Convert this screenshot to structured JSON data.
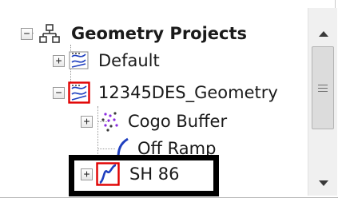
{
  "tree": {
    "root": {
      "label": "Geometry Projects",
      "expander": "−",
      "icon": "network-tree-icon"
    },
    "items": [
      {
        "label": "Default",
        "expander": "+",
        "icon": "alignment-set-icon"
      },
      {
        "label": "12345DES_Geometry",
        "expander": "−",
        "icon": "alignment-set-selected-icon"
      },
      {
        "label": "Cogo Buffer",
        "expander": "+",
        "icon": "cogo-points-icon"
      },
      {
        "label": "Off Ramp",
        "icon": "curve-alignment-icon"
      },
      {
        "label": "SH 86",
        "expander": "+",
        "icon": "curve-alignment-selected-icon"
      }
    ]
  },
  "scrollbar": {
    "up_icon": "scroll-up-arrow-icon",
    "down_icon": "scroll-down-arrow-icon"
  },
  "colors": {
    "selected_outline": "#e00000",
    "curve_blue": "#1f3fbf",
    "highlight_frame": "#000000"
  }
}
